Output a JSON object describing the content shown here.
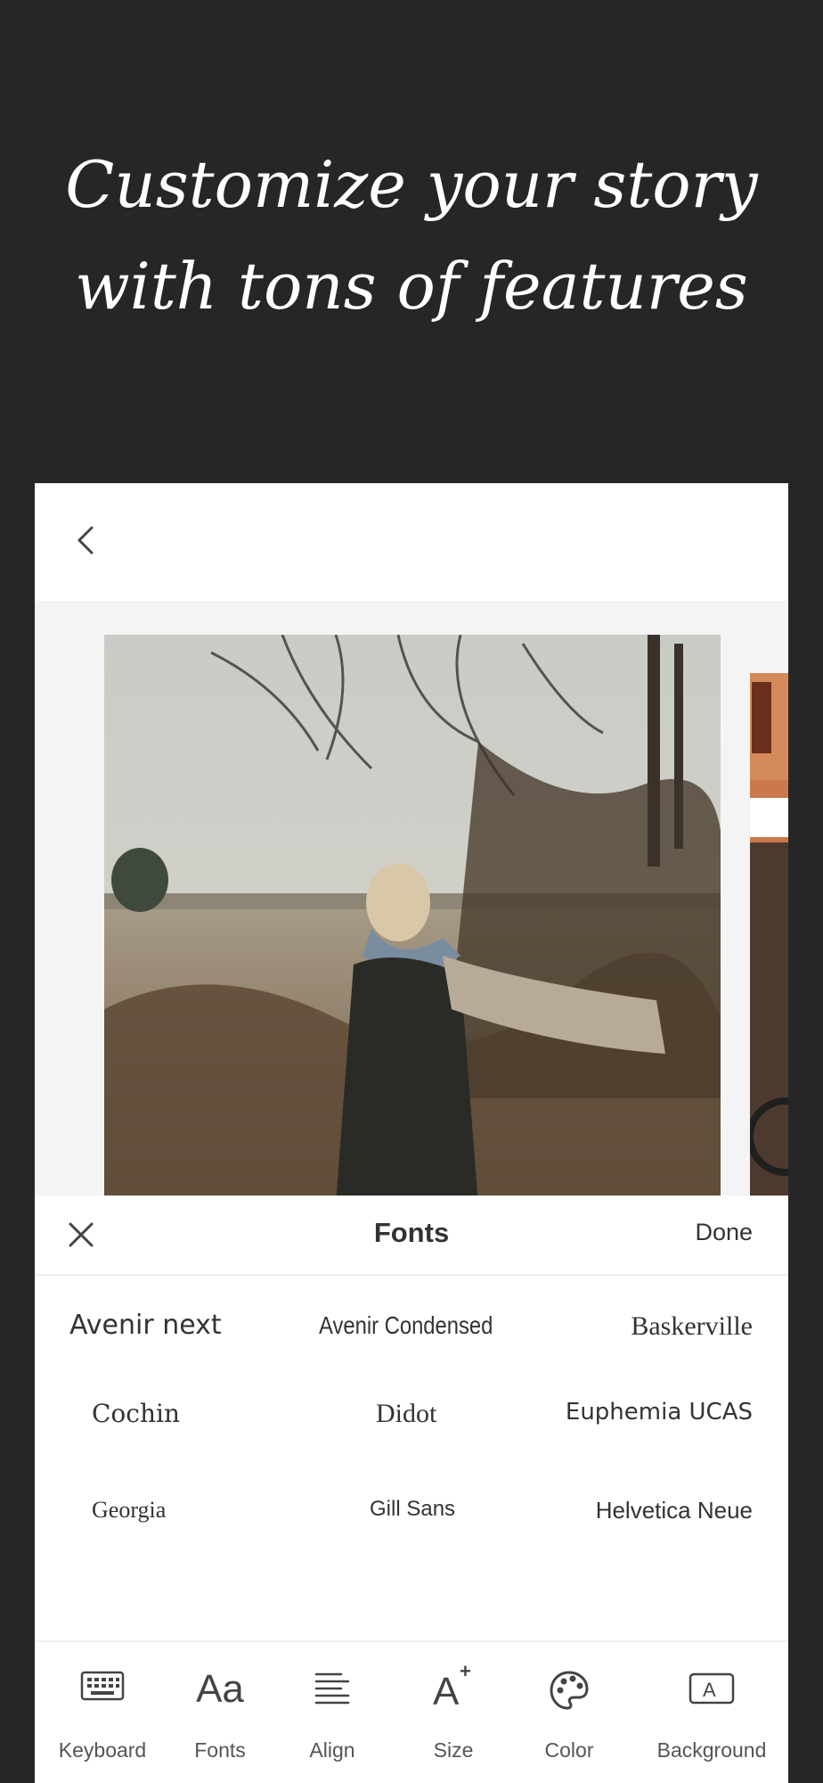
{
  "hero": {
    "line1": "Customize your story",
    "line2": "with tons of features"
  },
  "sheet": {
    "title": "Fonts",
    "done_label": "Done"
  },
  "fonts": [
    "Avenir next",
    "Avenir Condensed",
    "Baskerville",
    "Cochin",
    "Didot",
    "Euphemia  UCAS",
    "Georgia",
    "Gill Sans",
    "Helvetica Neue"
  ],
  "tools": [
    {
      "label": "Keyboard",
      "icon": "keyboard-icon"
    },
    {
      "label": "Fonts",
      "icon": "fonts-icon"
    },
    {
      "label": "Align",
      "icon": "align-icon"
    },
    {
      "label": "Size",
      "icon": "size-icon"
    },
    {
      "label": "Color",
      "icon": "palette-icon"
    },
    {
      "label": "Background",
      "icon": "background-icon"
    }
  ],
  "colors": {
    "page_bg": "#262626",
    "text_dark": "#333333"
  }
}
